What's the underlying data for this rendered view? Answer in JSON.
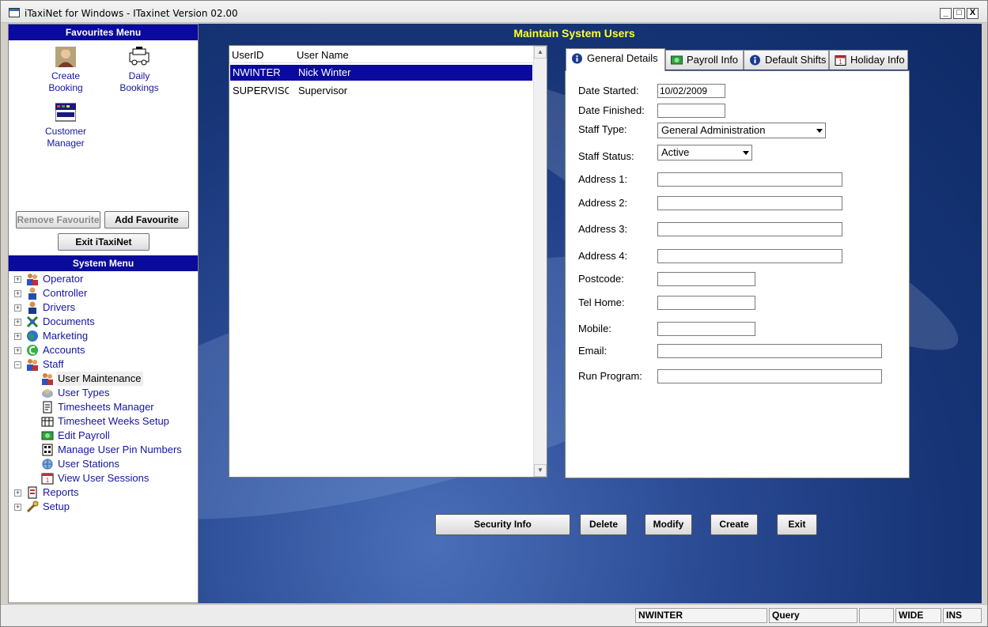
{
  "window": {
    "title": "iTaxiNet for Windows - ITaxinet Version 02.00",
    "minimize": "_",
    "maximize": "□",
    "close": "X"
  },
  "favourites": {
    "header": "Favourites Menu",
    "items": [
      {
        "line1": "Create",
        "line2": "Booking",
        "icon": "person-photo-icon"
      },
      {
        "line1": "Daily",
        "line2": "Bookings",
        "icon": "taxi-car-icon"
      },
      {
        "line1": "Customer",
        "line2": "Manager",
        "icon": "index-card-icon"
      }
    ],
    "remove_label": "Remove Favourite",
    "add_label": "Add Favourite",
    "exit_label": "Exit iTaxiNet"
  },
  "system_menu": {
    "header": "System Menu",
    "items": [
      {
        "label": "Operator",
        "expander": "+"
      },
      {
        "label": "Controller",
        "expander": "+"
      },
      {
        "label": "Drivers",
        "expander": "+"
      },
      {
        "label": "Documents",
        "expander": "+"
      },
      {
        "label": "Marketing",
        "expander": "+"
      },
      {
        "label": "Accounts",
        "expander": "+"
      },
      {
        "label": "Staff",
        "expander": "−"
      }
    ],
    "staff_children": [
      "User Maintenance",
      "User Types",
      "Timesheets Manager",
      "Timesheet Weeks Setup",
      "Edit Payroll",
      "Manage User Pin Numbers",
      "User Stations",
      "View User Sessions"
    ],
    "after_items": [
      {
        "label": "Reports",
        "expander": "+"
      },
      {
        "label": "Setup",
        "expander": "+"
      }
    ]
  },
  "main": {
    "title": "Maintain System Users",
    "list": {
      "headers": {
        "user_id": "UserID",
        "user_name": "User Name"
      },
      "rows": [
        {
          "user_id": "NWINTER",
          "user_name": "Nick Winter"
        },
        {
          "user_id": "SUPERVISOR",
          "user_name": "Supervisor"
        }
      ],
      "scroll_up": "▲",
      "scroll_down": "▼"
    },
    "tabs": [
      {
        "label": "General Details",
        "icon": "info-icon"
      },
      {
        "label": "Payroll Info",
        "icon": "money-icon"
      },
      {
        "label": "Default Shifts",
        "icon": "info-icon"
      },
      {
        "label": "Holiday Info",
        "icon": "calendar-icon"
      }
    ],
    "form": {
      "date_started_label": "Date Started:",
      "date_started_value": "10/02/2009",
      "date_finished_label": "Date Finished:",
      "date_finished_value": "",
      "staff_type_label": "Staff Type:",
      "staff_type_value": "General Administration",
      "staff_status_label": "Staff Status:",
      "staff_status_value": "Active",
      "address1_label": "Address 1:",
      "address2_label": "Address 2:",
      "address3_label": "Address 3:",
      "address4_label": "Address 4:",
      "postcode_label": "Postcode:",
      "tel_home_label": "Tel Home:",
      "mobile_label": "Mobile:",
      "email_label": "Email:",
      "run_program_label": "Run Program:"
    },
    "buttons": {
      "security": "Security Info",
      "delete": "Delete",
      "modify": "Modify",
      "create": "Create",
      "exit": "Exit"
    }
  },
  "statusbar": {
    "user": "NWINTER",
    "mode": "Query",
    "blank": "",
    "wide": "WIDE",
    "ins": "INS"
  }
}
